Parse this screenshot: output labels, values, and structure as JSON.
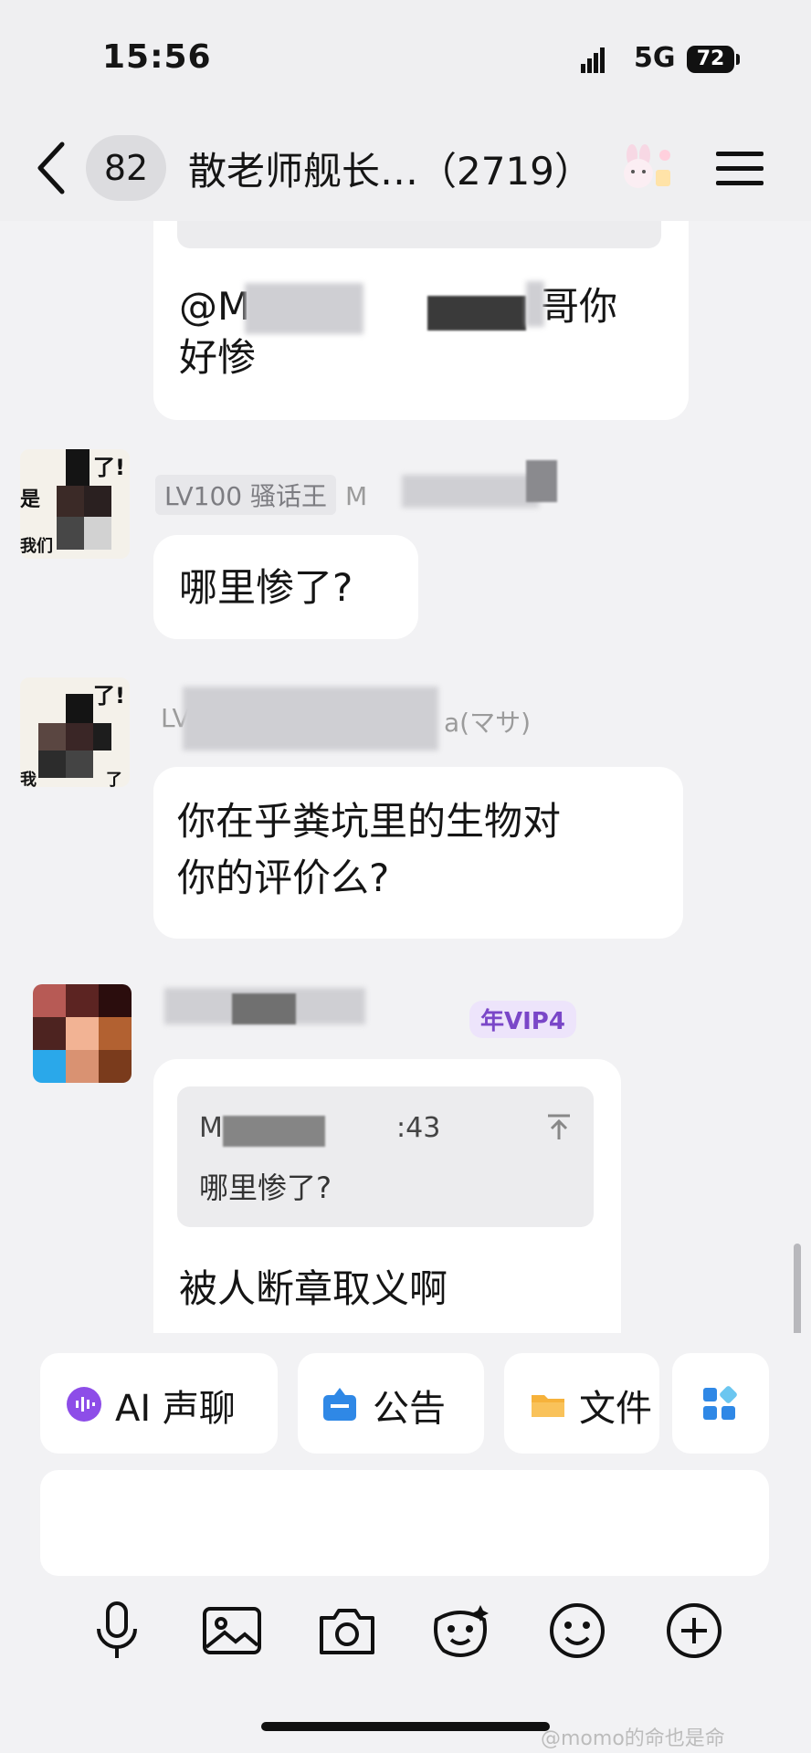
{
  "status_bar": {
    "time": "15:56",
    "network": "5G",
    "battery": "72"
  },
  "header": {
    "back_icon": "chevron-left-icon",
    "unread_count": "82",
    "title": "散老师舰长…（2719）",
    "menu_icon": "hamburger-menu-icon"
  },
  "messages": [
    {
      "id": "m1",
      "mention": "@M",
      "text_tail": "哥你",
      "text_line2": "好惨"
    },
    {
      "id": "m2",
      "level": "LV100 骚话王",
      "sender_fragment": "M",
      "text": "哪里惨了?"
    },
    {
      "id": "m3",
      "level_fragment": "LV",
      "sender_fragment": "a(マサ)",
      "text_line1": "你在乎粪坑里的生物对",
      "text_line2": "你的评价么?"
    },
    {
      "id": "m4",
      "vip_badge": "年VIP4",
      "quote_head_fragment": "M",
      "quote_time_fragment": ":43",
      "quote_text": "哪里惨了?",
      "text": "被人断章取义啊"
    }
  ],
  "quick_actions": [
    {
      "label": "AI 声聊",
      "icon": "ai-voice-icon",
      "color": "#8d4de8"
    },
    {
      "label": "公告",
      "icon": "announcement-icon",
      "color": "#2f88e6"
    },
    {
      "label": "文件",
      "icon": "folder-icon",
      "color": "#f6b23b"
    },
    {
      "label": "",
      "icon": "apps-grid-icon",
      "color": "#2f88e6"
    }
  ],
  "input": {
    "placeholder": "",
    "value": ""
  },
  "toolbar": [
    "microphone-icon",
    "image-icon",
    "camera-icon",
    "sticker-icon",
    "emoji-icon",
    "plus-icon"
  ],
  "watermark": "@momo的命也是命"
}
